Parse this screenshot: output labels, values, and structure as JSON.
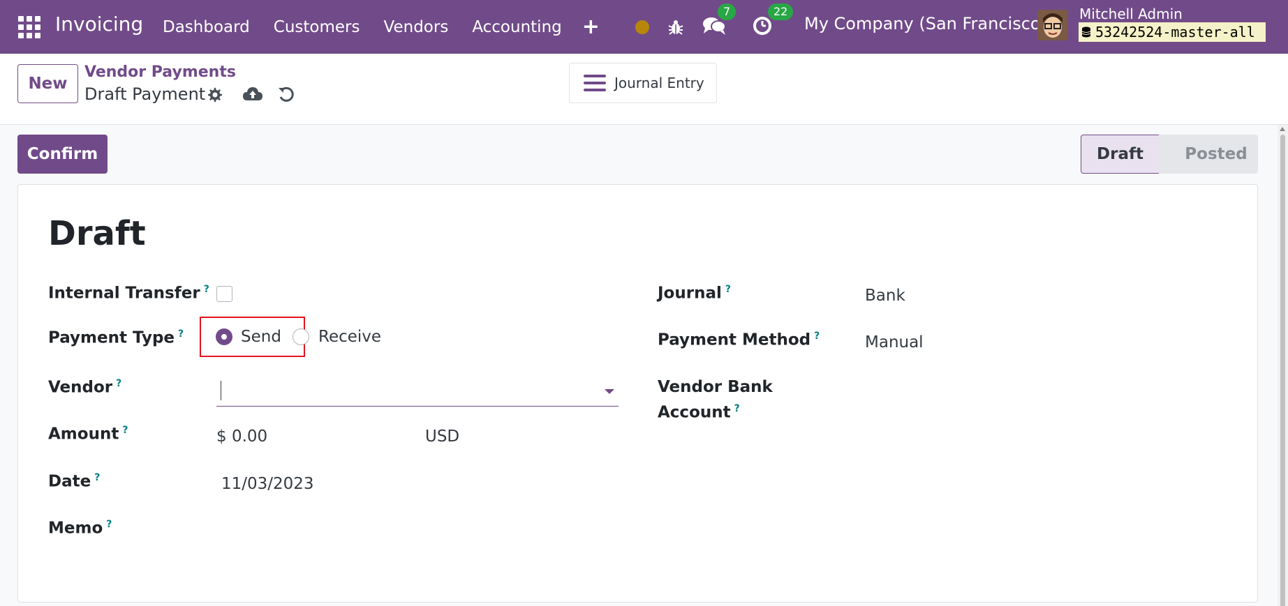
{
  "navbar": {
    "app_name": "Invoicing",
    "menu": [
      "Dashboard",
      "Customers",
      "Vendors",
      "Accounting"
    ],
    "messages_count": "7",
    "activities_count": "22",
    "company": "My Company (San Francisco)",
    "user_name": "Mitchell Admin",
    "database": "53242524-master-all"
  },
  "control_panel": {
    "new_label": "New",
    "breadcrumb": "Vendor Payments",
    "record_name": "Draft Payment",
    "journal_entry_label": "Journal Entry"
  },
  "actions": {
    "confirm_label": "Confirm"
  },
  "statusbar": {
    "stages": [
      "Draft",
      "Posted"
    ],
    "current": "Draft"
  },
  "form": {
    "title": "Draft",
    "labels": {
      "internal_transfer": "Internal Transfer",
      "payment_type": "Payment Type",
      "vendor": "Vendor",
      "amount": "Amount",
      "date": "Date",
      "memo": "Memo",
      "journal": "Journal",
      "payment_method": "Payment Method",
      "vendor_bank_line1": "Vendor Bank",
      "vendor_bank_line2": "Account"
    },
    "help_mark": "?",
    "payment_type_options": [
      "Send",
      "Receive"
    ],
    "payment_type_selected": "Send",
    "vendor_value": "",
    "amount": "$ 0.00",
    "currency": "USD",
    "date": "11/03/2023",
    "journal": "Bank",
    "payment_method": "Manual"
  },
  "colors": {
    "brand": "#714b89",
    "badge": "#28a745",
    "highlight": "#e0141e",
    "help": "#017e84"
  }
}
